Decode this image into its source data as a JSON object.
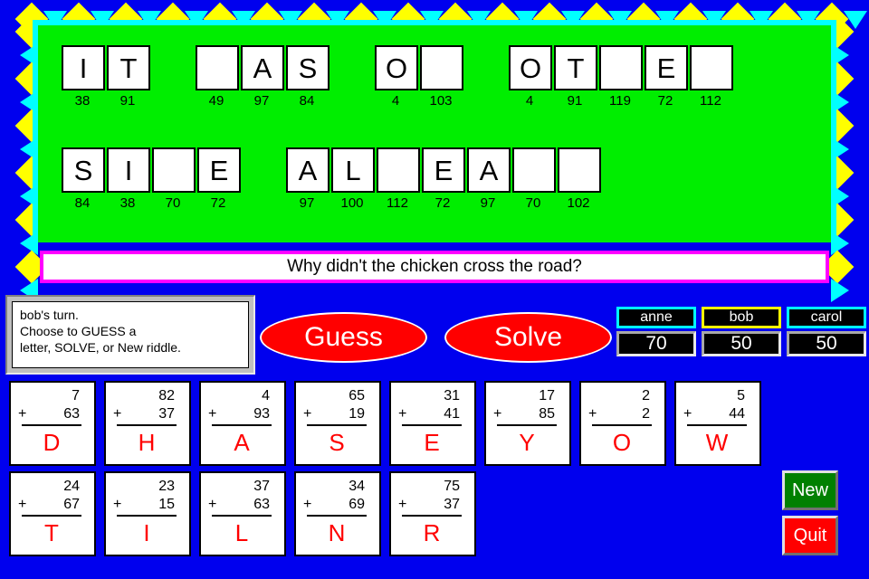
{
  "theme": {
    "background": "#0000EE",
    "board_green": "#00EE00",
    "board_cyan": "#00FFFF",
    "deco_yellow": "#FFFF00",
    "riddle_border": "#FF00FF",
    "letter_red": "#FF0000",
    "active_player_border": "#FFFF00"
  },
  "puzzle": {
    "rows": [
      {
        "words": [
          {
            "letters": [
              "I",
              "T"
            ],
            "numbers": [
              38,
              91
            ]
          },
          {
            "letters": [
              "",
              "A",
              "S"
            ],
            "numbers": [
              49,
              97,
              84
            ]
          },
          {
            "letters": [
              "O",
              ""
            ],
            "numbers": [
              4,
              103
            ]
          },
          {
            "letters": [
              "O",
              "T",
              "",
              "E",
              ""
            ],
            "numbers": [
              4,
              91,
              119,
              72,
              112
            ]
          }
        ]
      },
      {
        "words": [
          {
            "letters": [
              "S",
              "I",
              "",
              "E"
            ],
            "numbers": [
              84,
              38,
              70,
              72
            ]
          },
          {
            "letters": [
              "A",
              "L",
              "",
              "E",
              "A",
              "",
              ""
            ],
            "numbers": [
              97,
              100,
              112,
              72,
              97,
              70,
              102
            ]
          }
        ]
      }
    ]
  },
  "riddle": {
    "text": "Why didn't the chicken cross the road?"
  },
  "message": {
    "lines": [
      "bob's turn.",
      "Choose to  GUESS  a",
      "letter,  SOLVE,  or  New  riddle."
    ]
  },
  "actions": {
    "guess_label": "Guess",
    "solve_label": "Solve",
    "new_label": "New",
    "quit_label": "Quit"
  },
  "players": [
    {
      "name": "anne",
      "score": "70",
      "active": false
    },
    {
      "name": "bob",
      "score": "50",
      "active": true
    },
    {
      "name": "carol",
      "score": "50",
      "active": false
    }
  ],
  "cards": [
    {
      "top": "7",
      "op": "+",
      "bottom": "63",
      "letter": "D"
    },
    {
      "top": "82",
      "op": "+",
      "bottom": "37",
      "letter": "H"
    },
    {
      "top": "4",
      "op": "+",
      "bottom": "93",
      "letter": "A"
    },
    {
      "top": "65",
      "op": "+",
      "bottom": "19",
      "letter": "S"
    },
    {
      "top": "31",
      "op": "+",
      "bottom": "41",
      "letter": "E"
    },
    {
      "top": "17",
      "op": "+",
      "bottom": "85",
      "letter": "Y"
    },
    {
      "top": "2",
      "op": "+",
      "bottom": "2",
      "letter": "O"
    },
    {
      "top": "5",
      "op": "+",
      "bottom": "44",
      "letter": "W"
    },
    {
      "top": "24",
      "op": "+",
      "bottom": "67",
      "letter": "T"
    },
    {
      "top": "23",
      "op": "+",
      "bottom": "15",
      "letter": "I"
    },
    {
      "top": "37",
      "op": "+",
      "bottom": "63",
      "letter": "L"
    },
    {
      "top": "34",
      "op": "+",
      "bottom": "69",
      "letter": "N"
    },
    {
      "top": "75",
      "op": "+",
      "bottom": "37",
      "letter": "R"
    }
  ]
}
